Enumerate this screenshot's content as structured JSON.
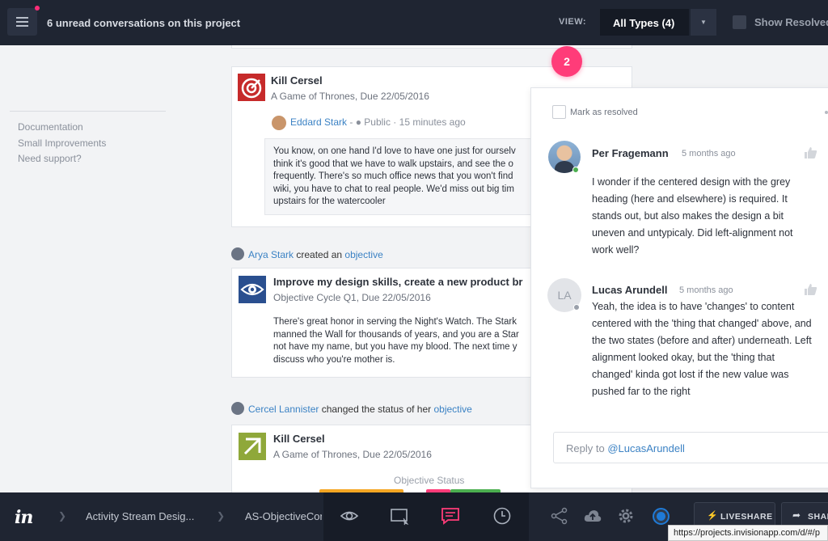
{
  "header": {
    "unread": "6 unread conversations on this project",
    "view_label": "VIEW:",
    "view_value": "All Types (4)",
    "show_resolved": "Show Resolved"
  },
  "sidebar": {
    "links": [
      "Documentation",
      "Small Improvements",
      "Need support?"
    ]
  },
  "feed": {
    "card1": {
      "title": "Kill Cersel",
      "subtitle": "A Game of Thrones, Due 22/05/2016",
      "comment_author": "Eddard Stark",
      "comment_meta": " - ● Public · 15 minutes ago",
      "comment_text": "You know, on one hand I'd love to have one just for ourselv\nthink it's good that we have to walk upstairs, and see the o\nfrequently. There's so much office news that you won't find\nwiki, you have to chat to real people. We'd miss out big tim\nupstairs for the watercooler"
    },
    "activity2": {
      "actor": "Arya Stark",
      "verb": " created an ",
      "object": "objective"
    },
    "card2": {
      "title": "Improve my design skills, create a new product br",
      "subtitle": "Objective Cycle Q1, Due 22/05/2016",
      "body": "There's great honor in serving the Night's Watch. The Stark\nmanned the Wall for thousands of years, and you are a Star\nnot have my name, but you have my blood. The next time y\ndiscuss who you're mother is."
    },
    "activity3": {
      "actor": "Cercel Lannister",
      "verb": " changed the status of her ",
      "object": "objective"
    },
    "card3": {
      "title": "Kill Cersel",
      "subtitle": "A Game of Thrones, Due 22/05/2016",
      "status_label": "Objective Status"
    }
  },
  "popover": {
    "pin_number": "2",
    "mark_resolved": "Mark as resolved",
    "comments": [
      {
        "author": "Per Fragemann",
        "time": "5 months ago",
        "text": "I wonder if the centered design with the grey\nheading (here and elsewhere) is required. It\nstands out, but also makes the design a bit\nuneven and untypicaly. Did left-alignment not\nwork well?"
      },
      {
        "author": "Lucas Arundell",
        "initials": "LA",
        "time": "5 months ago",
        "text": "Yeah, the idea is to have 'changes' to content\ncentered with the 'thing that changed' above, and\nthe two states (before and after) underneath. Left\nalignment looked okay, but the 'thing that\nchanged' kinda got lost if the new value was\npushed far to the right"
      }
    ],
    "reply_prefix": "Reply to ",
    "reply_handle": "@LucasArundell"
  },
  "bottombar": {
    "logo": "in",
    "crumb1": "Activity Stream Desig...",
    "crumb2": "AS-ObjectiveCon",
    "liveshare": "LIVESHARE",
    "share": "SHARE"
  },
  "status_url": "https://projects.invisionapp.com/d/#/p",
  "colors": {
    "accent": "#ff3c79",
    "link": "#3b82c4",
    "online": "#4caf50",
    "dark": "#1f2532"
  }
}
